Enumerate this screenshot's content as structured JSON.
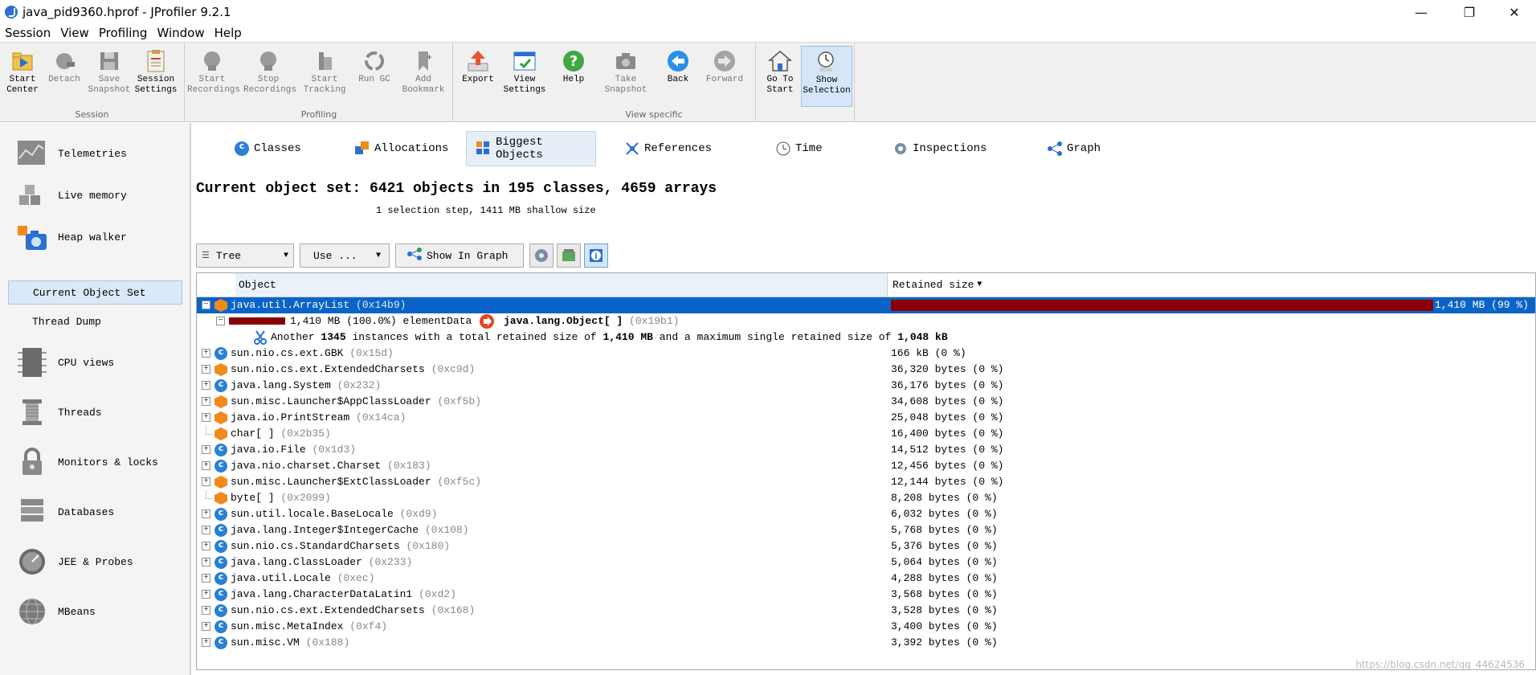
{
  "window": {
    "title": "java_pid9360.hprof - JProfiler 9.2.1",
    "minimize_glyph": "—",
    "restore_glyph": "❐",
    "close_glyph": "✕"
  },
  "menu": [
    "Session",
    "View",
    "Profiling",
    "Window",
    "Help"
  ],
  "toolbar": {
    "groups": [
      {
        "label": "Session"
      },
      {
        "label": "Profiling"
      },
      {
        "label": "View specific"
      }
    ],
    "buttons": {
      "start_center": "Start\nCenter",
      "detach": "Detach",
      "save_snapshot": "Save\nSnapshot",
      "session_settings": "Session\nSettings",
      "start_recordings": "Start\nRecordings",
      "stop_recordings": "Stop\nRecordings",
      "start_tracking": "Start\nTracking",
      "run_gc": "Run GC",
      "add_bookmark": "Add\nBookmark",
      "export": "Export",
      "view_settings": "View\nSettings",
      "help": "Help",
      "take_snapshot": "Take\nSnapshot",
      "back": "Back",
      "forward": "Forward",
      "go_to_start": "Go To\nStart",
      "show_selection": "Show\nSelection"
    }
  },
  "sidebar": {
    "items": {
      "telemetries": "Telemetries",
      "live_memory": "Live memory",
      "heap_walker": "Heap walker",
      "current_object_set": "Current Object Set",
      "thread_dump": "Thread Dump",
      "cpu_views": "CPU views",
      "threads": "Threads",
      "monitors_locks": "Monitors & locks",
      "databases": "Databases",
      "jee_probes": "JEE & Probes",
      "mbeans": "MBeans"
    }
  },
  "view_tabs": {
    "classes": "Classes",
    "allocations": "Allocations",
    "biggest_objects": "Biggest Objects",
    "references": "References",
    "time": "Time",
    "inspections": "Inspections",
    "graph": "Graph"
  },
  "summary": {
    "title": "Current object set: 6421 objects in 195 classes, 4659 arrays",
    "subtitle": "1 selection step, 1411 MB shallow size"
  },
  "controls": {
    "view_mode": "Tree",
    "use_menu": "Use ...",
    "show_in_graph": "Show In Graph"
  },
  "table": {
    "col_object": "Object",
    "col_retained": "Retained size",
    "sort_glyph": "▼",
    "top_row": {
      "name": "java.util.ArrayList",
      "addr": "(0x14b9)",
      "retained": "1,410 MB (99 %)",
      "bar_fraction": 0.99
    },
    "child_row": {
      "size": "1,410 MB (100.0%)",
      "field": "elementData",
      "type": "java.lang.Object[ ]",
      "addr": "(0x19b1)",
      "bar_fraction": 1.0
    },
    "another_row": {
      "prefix": "Another",
      "count": "1345",
      "middle": "instances with a total retained size of",
      "total": "1,410 MB",
      "suffix": "and a maximum single retained size of",
      "max": "1,048 kB"
    },
    "rows": [
      {
        "name": "sun.nio.cs.ext.GBK",
        "addr": "(0x15d)",
        "retained": "166 kB (0 %)",
        "icon": "class",
        "expandable": true
      },
      {
        "name": "sun.nio.cs.ext.ExtendedCharsets",
        "addr": "(0xc9d)",
        "retained": "36,320 bytes (0 %)",
        "icon": "object",
        "expandable": true
      },
      {
        "name": "java.lang.System",
        "addr": "(0x232)",
        "retained": "36,176 bytes (0 %)",
        "icon": "class",
        "expandable": true
      },
      {
        "name": "sun.misc.Launcher$AppClassLoader",
        "addr": "(0xf5b)",
        "retained": "34,608 bytes (0 %)",
        "icon": "object",
        "expandable": true
      },
      {
        "name": "java.io.PrintStream",
        "addr": "(0x14ca)",
        "retained": "25,048 bytes (0 %)",
        "icon": "object",
        "expandable": true
      },
      {
        "name": "char[ ]",
        "addr": "(0x2b35)",
        "retained": "16,400 bytes (0 %)",
        "icon": "object",
        "expandable": false
      },
      {
        "name": "java.io.File",
        "addr": "(0x1d3)",
        "retained": "14,512 bytes (0 %)",
        "icon": "class",
        "expandable": true
      },
      {
        "name": "java.nio.charset.Charset",
        "addr": "(0x183)",
        "retained": "12,456 bytes (0 %)",
        "icon": "class",
        "expandable": true
      },
      {
        "name": "sun.misc.Launcher$ExtClassLoader",
        "addr": "(0xf5c)",
        "retained": "12,144 bytes (0 %)",
        "icon": "object",
        "expandable": true
      },
      {
        "name": "byte[ ]",
        "addr": "(0x2099)",
        "retained": "8,208 bytes (0 %)",
        "icon": "object",
        "expandable": false
      },
      {
        "name": "sun.util.locale.BaseLocale",
        "addr": "(0xd9)",
        "retained": "6,032 bytes (0 %)",
        "icon": "class",
        "expandable": true
      },
      {
        "name": "java.lang.Integer$IntegerCache",
        "addr": "(0x108)",
        "retained": "5,768 bytes (0 %)",
        "icon": "class",
        "expandable": true
      },
      {
        "name": "sun.nio.cs.StandardCharsets",
        "addr": "(0x180)",
        "retained": "5,376 bytes (0 %)",
        "icon": "class",
        "expandable": true
      },
      {
        "name": "java.lang.ClassLoader",
        "addr": "(0x233)",
        "retained": "5,064 bytes (0 %)",
        "icon": "class",
        "expandable": true
      },
      {
        "name": "java.util.Locale",
        "addr": "(0xec)",
        "retained": "4,288 bytes (0 %)",
        "icon": "class",
        "expandable": true
      },
      {
        "name": "java.lang.CharacterDataLatin1",
        "addr": "(0xd2)",
        "retained": "3,568 bytes (0 %)",
        "icon": "class",
        "expandable": true
      },
      {
        "name": "sun.nio.cs.ext.ExtendedCharsets",
        "addr": "(0x168)",
        "retained": "3,528 bytes (0 %)",
        "icon": "class",
        "expandable": true
      },
      {
        "name": "sun.misc.MetaIndex",
        "addr": "(0xf4)",
        "retained": "3,400 bytes (0 %)",
        "icon": "class",
        "expandable": true
      },
      {
        "name": "sun.misc.VM",
        "addr": "(0x188)",
        "retained": "3,392 bytes (0 %)",
        "icon": "class",
        "expandable": true
      }
    ]
  },
  "watermark": "https://blog.csdn.net/qq_44624536",
  "colors": {
    "selection": "#0a64c8",
    "bar": "#8b0000",
    "accent_orange": "#f08a1a",
    "class_blue": "#2a7fd6"
  }
}
